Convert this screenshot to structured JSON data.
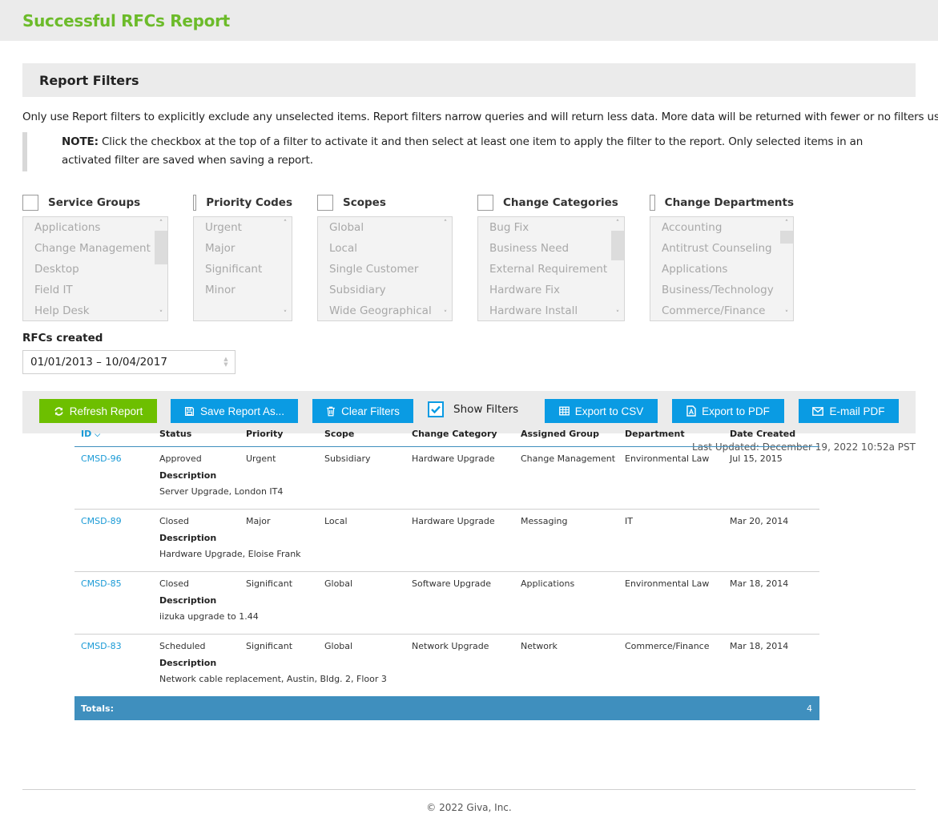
{
  "header": {
    "title": "Successful RFCs Report"
  },
  "filters": {
    "title": "Report Filters",
    "intro": "Only use Report filters to explicitly exclude any unselected items. Report filters narrow queries and will return less data. More data will be returned with fewer or no filters used.",
    "note_label": "NOTE:",
    "note_text": " Click the checkbox at the top of a filter to activate it and then select at least one item to apply the filter to the report. Only selected items in an activated filter are saved when saving a report.",
    "groups": [
      {
        "label": "Service Groups",
        "checked": false,
        "items": [
          "Applications",
          "Change Management",
          "Desktop",
          "Field IT",
          "Help Desk"
        ]
      },
      {
        "label": "Priority Codes",
        "checked": false,
        "items": [
          "Urgent",
          "Major",
          "Significant",
          "Minor"
        ]
      },
      {
        "label": "Scopes",
        "checked": false,
        "items": [
          "Global",
          "Local",
          "Single Customer",
          "Subsidiary",
          "Wide Geographical"
        ]
      },
      {
        "label": "Change Categories",
        "checked": false,
        "items": [
          "Bug Fix",
          "Business Need",
          "External Requirement",
          "Hardware Fix",
          "Hardware Install"
        ]
      },
      {
        "label": "Change Departments",
        "checked": false,
        "items": [
          "Accounting",
          "Antitrust Counseling",
          "Applications",
          "Business/Technology",
          "Commerce/Finance"
        ]
      }
    ],
    "date_label": "RFCs created",
    "date_value": "01/01/2013 – 10/04/2017"
  },
  "toolbar": {
    "refresh": "Refresh Report",
    "save_as": "Save Report As...",
    "clear": "Clear Filters",
    "show_filters": "Show Filters",
    "show_filters_checked": true,
    "export_csv": "Export to CSV",
    "export_pdf": "Export to PDF",
    "email_pdf": "E-mail PDF"
  },
  "last_updated": "Last Updated: December 19, 2022 10:52a PST",
  "table": {
    "columns": [
      "ID",
      "Status",
      "Priority",
      "Scope",
      "Change Category",
      "Assigned Group",
      "Department",
      "Date Created"
    ],
    "sort_column": "ID",
    "sort_dir": "desc",
    "desc_label": "Description",
    "rows": [
      {
        "id": "CMSD-96",
        "status": "Approved",
        "priority": "Urgent",
        "scope": "Subsidiary",
        "category": "Hardware Upgrade",
        "group": "Change Management",
        "department": "Environmental Law",
        "date": "Jul 15, 2015",
        "description": "Server Upgrade, London IT4"
      },
      {
        "id": "CMSD-89",
        "status": "Closed",
        "priority": "Major",
        "scope": "Local",
        "category": "Hardware Upgrade",
        "group": "Messaging",
        "department": "IT",
        "date": "Mar 20, 2014",
        "description": "Hardware Upgrade, Eloise Frank"
      },
      {
        "id": "CMSD-85",
        "status": "Closed",
        "priority": "Significant",
        "scope": "Global",
        "category": "Software Upgrade",
        "group": "Applications",
        "department": "Environmental Law",
        "date": "Mar 18, 2014",
        "description": "iizuka upgrade to 1.44"
      },
      {
        "id": "CMSD-83",
        "status": "Scheduled",
        "priority": "Significant",
        "scope": "Global",
        "category": "Network Upgrade",
        "group": "Network",
        "department": "Commerce/Finance",
        "date": "Mar 18, 2014",
        "description": "Network cable replacement, Austin, Bldg. 2, Floor 3"
      }
    ],
    "totals_label": "Totals:",
    "totals_count": "4"
  },
  "footer": {
    "copyright": "© 2022 Giva, Inc."
  },
  "colors": {
    "brand_green": "#6cbb2a",
    "button_green": "#6dbf00",
    "button_blue": "#0a9be3",
    "totals_bar": "#3f8fbe",
    "link": "#1a9ad6"
  }
}
